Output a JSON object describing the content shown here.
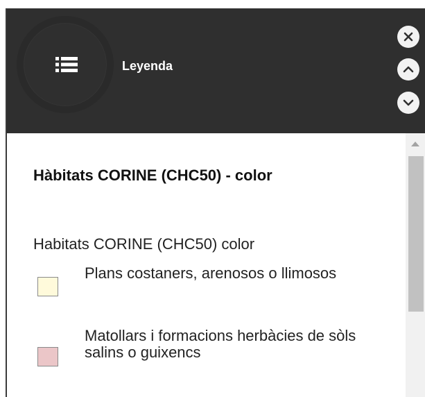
{
  "panel": {
    "title": "Leyenda",
    "icons": {
      "main": "list-icon",
      "close": "close-icon",
      "up": "chevron-up-icon",
      "down": "chevron-down-icon"
    },
    "colors": {
      "header_bg": "#2f2f2f",
      "content_bg": "#ffffff"
    }
  },
  "legend": {
    "layer_title": "Hàbitats CORINE (CHC50) - color",
    "layer_subtitle": "Habitats CORINE (CHC50) color",
    "items": [
      {
        "label": "Plans costaners, arenosos o llimosos",
        "color": "#fffadb"
      },
      {
        "label": "Matollars i formacions herbàcies de sòls salins o guixencs",
        "color": "#ebc6c8"
      }
    ]
  }
}
